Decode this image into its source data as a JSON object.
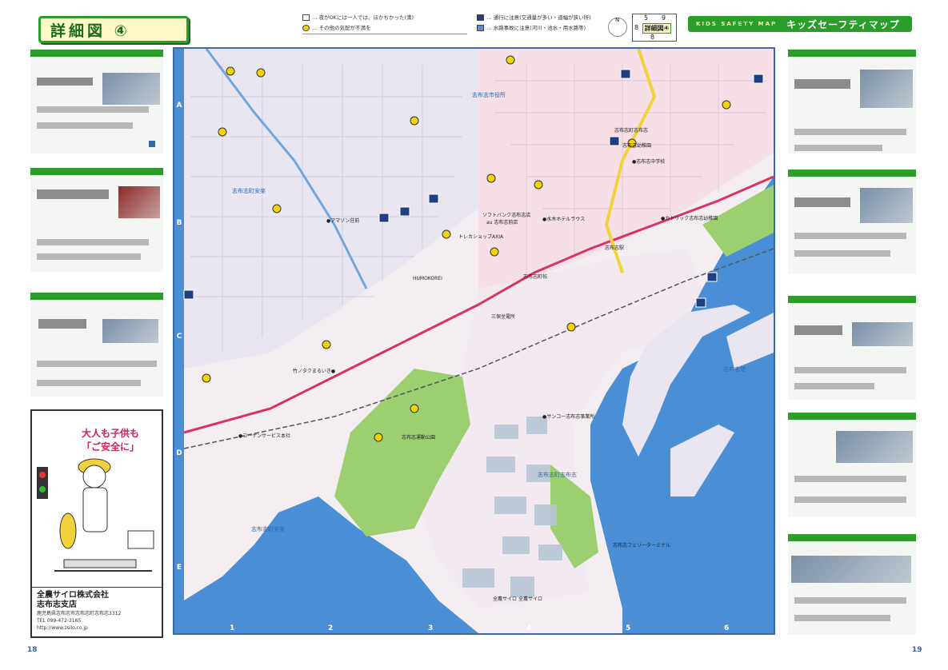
{
  "header": {
    "title": "詳細図 ④",
    "brand_en": "KIDS SAFETY MAP",
    "brand_jp": "キッズセーフティマップ",
    "legend_left": [
      "… 夜がOKには一人では、ほかちかった(満)",
      "… その他の気配が不満を"
    ],
    "legend_right": [
      "… 通行に注意(交通量が多い・道幅が狭い所)",
      "… 水路事故に注意(河川・池水・用水路等)"
    ],
    "index": {
      "top_left": "5",
      "top_right": "9",
      "mid_left": "8",
      "bottom": "8",
      "active": "詳細図④"
    }
  },
  "map": {
    "row_labels": [
      "A",
      "B",
      "C",
      "D",
      "E"
    ],
    "col_labels": [
      "1",
      "2",
      "3",
      "4",
      "5",
      "6"
    ],
    "places": [
      {
        "id": "shibushi-annaku",
        "text": "志布志町安楽"
      },
      {
        "id": "amazon",
        "text": "●アマゾン荘前"
      },
      {
        "id": "humokorei",
        "text": "HUMOKOREI"
      },
      {
        "id": "softbank",
        "text": "ソフトバンク志布志店"
      },
      {
        "id": "au",
        "text": "au 志布志前店"
      },
      {
        "id": "axia",
        "text": "トレカショップAXIA"
      },
      {
        "id": "sakura",
        "text": "●水木ホテルラウス"
      },
      {
        "id": "shiyakusho",
        "text": "志布志市役所"
      },
      {
        "id": "shibushi-shibushi",
        "text": "志布志町志布志"
      },
      {
        "id": "station",
        "text": "志布志駅"
      },
      {
        "id": "catholic",
        "text": "●カトリック志布志幼稚園"
      },
      {
        "id": "kindergarten",
        "text": "志布志幼稚園"
      },
      {
        "id": "chuo-shogakko",
        "text": "●志布志中学校"
      },
      {
        "id": "port",
        "text": "志布志港"
      },
      {
        "id": "ferry",
        "text": "志布志フェリーターミナル"
      },
      {
        "id": "park",
        "text": "志布志運動公園"
      },
      {
        "id": "sanko",
        "text": "●サンコー志布志事業所"
      },
      {
        "id": "kogyo",
        "text": "●コーケンサービス本社"
      },
      {
        "id": "zenno",
        "text": "全農サイロ"
      },
      {
        "id": "silo",
        "text": "全農サイロ"
      },
      {
        "id": "annaku-bottom",
        "text": "志布志町安楽"
      },
      {
        "id": "shibushi-mid",
        "text": "志布志町志布志"
      },
      {
        "id": "sanpou",
        "text": "三保坐電所"
      },
      {
        "id": "ikiyu",
        "text": "志布志町帖"
      },
      {
        "id": "tsuru",
        "text": "竹ノタクまるいき●"
      }
    ]
  },
  "sponsor": {
    "slogan_line1": "大人も子供も",
    "slogan_line2": "「ご安全に」",
    "company_name": "全農サイロ株式会社",
    "company_branch": "志布志支店",
    "address": "鹿児島県志布志市志布志町志布志3312",
    "tel": "TEL 099-472-3165",
    "url": "http://www.zsilo.co.jp"
  },
  "pages": {
    "left": "18",
    "right": "19"
  }
}
